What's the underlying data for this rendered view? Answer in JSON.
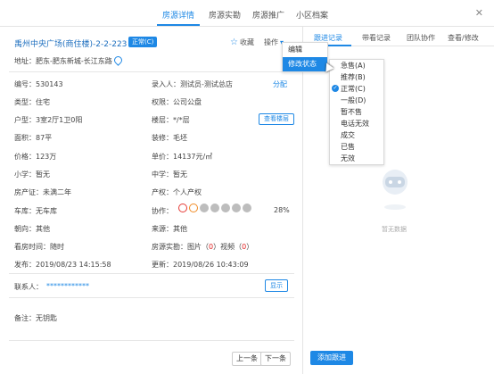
{
  "top_tabs": [
    "房源详情",
    "房源实勘",
    "房源推广",
    "小区档案"
  ],
  "close_glyph": "✕",
  "listing": {
    "title": "禹州中央广场(商住楼)-2-2-223",
    "status_badge": "正常(C)",
    "favorite_label": "收藏",
    "operate_label": "操作",
    "address": "地址：肥东-肥东新城-长江东路"
  },
  "fields": {
    "code": "编号：530143",
    "entered_by": "录入人：测试员-测试总店",
    "assign_link": "分配",
    "type": "类型：住宅",
    "ownership": "权限：公司公盘",
    "layout": "户型：3室2厅1卫0阳",
    "floor": "楼层：*/*层",
    "floor_button": "查看楼层",
    "area": "面积：87平",
    "decoration": "装修：毛坯",
    "price": "价格：123万",
    "unit_price": "单价：14137元/㎡",
    "primary_school": "小学：暂无",
    "middle_school": "中学：暂无",
    "cert": "房产证：未满二年",
    "property_right": "产权：个人产权",
    "garage": "车库：无车库",
    "collab_label": "协作：",
    "collab_percent": "28%",
    "orientation": "朝向：其他",
    "source": "来源：其他",
    "viewing_time": "看房时间：随时",
    "survey_prefix": "房源实勘：图片（",
    "survey_pic_count": "0",
    "survey_mid": "）视频（",
    "survey_video_count": "0",
    "survey_suffix": "）",
    "published": "发布：2019/08/23 14:15:58",
    "updated": "更新：2019/08/26 10:43:09",
    "contact_label": "联系人：",
    "contact_value": "************",
    "show_button": "显示",
    "remark": "备注：无钥匙"
  },
  "pager": {
    "prev": "上一条",
    "next": "下一条"
  },
  "right_tabs": [
    "跟进记录",
    "带看记录",
    "团队协作",
    "查看/修改"
  ],
  "empty_text": "暂无数据",
  "add_followup": "添加跟进",
  "operate_menu": [
    "编辑",
    "修改状态"
  ],
  "status_menu": [
    "急售(A)",
    "推荐(B)",
    "正常(C)",
    "一般(D)",
    "暂不售",
    "电话无效",
    "成交",
    "已售",
    "无效"
  ],
  "status_checked_index": 2,
  "colors": {
    "accent": "#1e88e5",
    "red": "#e02020"
  }
}
